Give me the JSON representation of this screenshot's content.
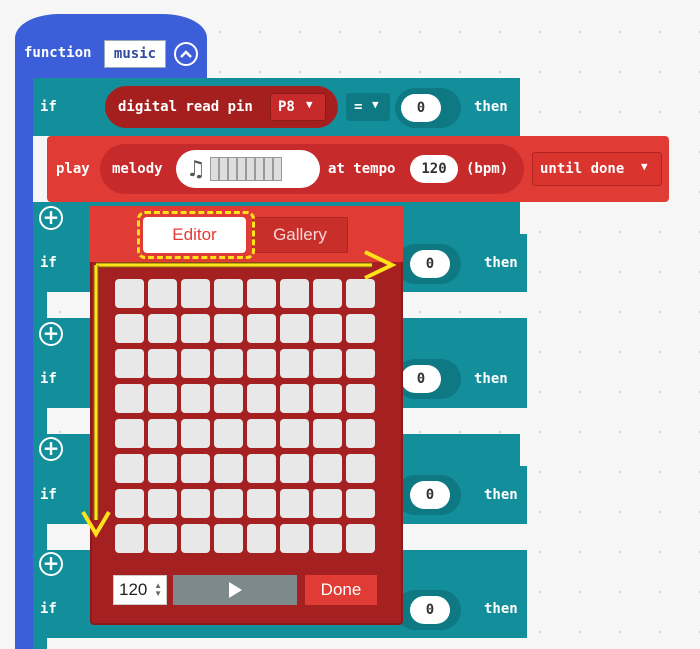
{
  "function_block": {
    "keyword": "function",
    "name": "music"
  },
  "if_blocks": [
    {
      "keyword": "if",
      "value": "0",
      "then": "then"
    },
    {
      "keyword": "if",
      "value": "0",
      "then": "then"
    },
    {
      "keyword": "if",
      "value": "0",
      "then": "then"
    },
    {
      "keyword": "if",
      "value": "0",
      "then": "then"
    },
    {
      "keyword": "if",
      "value": "0",
      "then": "then"
    }
  ],
  "condition": {
    "label": "digital read pin",
    "pin": "P8",
    "operator": "="
  },
  "play_block": {
    "play": "play",
    "melody": "melody",
    "at_tempo": "at tempo",
    "tempo": "120",
    "bpm": "(bpm)",
    "mode": "until done"
  },
  "popup": {
    "tabs": [
      {
        "label": "Editor",
        "active": true
      },
      {
        "label": "Gallery",
        "active": false
      }
    ],
    "tempo_value": "120",
    "done_label": "Done",
    "grid": {
      "rows": 8,
      "cols": 8
    }
  },
  "colors": {
    "function_blue": "#3c5ed8",
    "logic_teal": "#138f9c",
    "music_red": "#e03b34",
    "annotation_yellow": "#ffe31a"
  },
  "icons": [
    "chevron-up-icon",
    "plus-icon",
    "music-note-icon",
    "play-icon",
    "dropdown-arrow-icon"
  ]
}
